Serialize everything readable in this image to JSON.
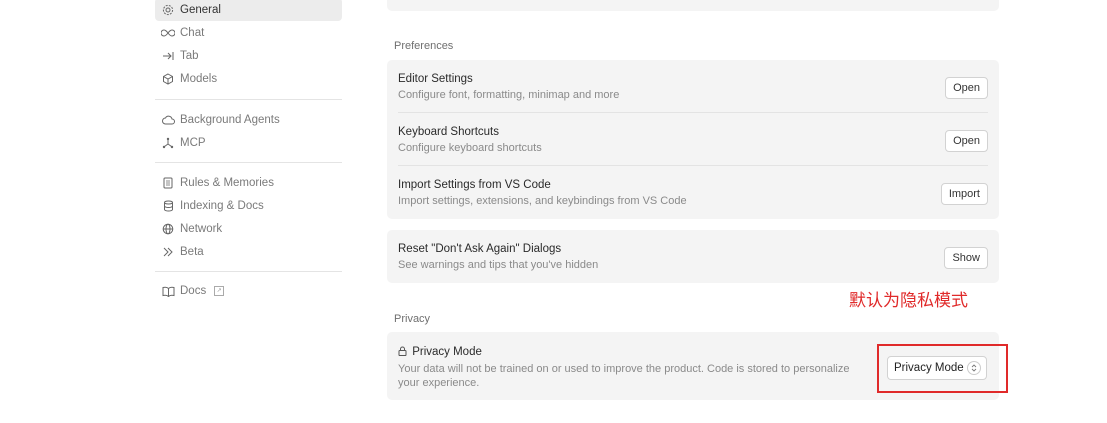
{
  "sidebar": {
    "items": [
      {
        "label": "General",
        "icon": "gear-icon"
      },
      {
        "label": "Chat",
        "icon": "infinity-icon"
      },
      {
        "label": "Tab",
        "icon": "tab-arrow-icon"
      },
      {
        "label": "Models",
        "icon": "cube-icon"
      },
      {
        "label": "Background Agents",
        "icon": "cloud-icon"
      },
      {
        "label": "MCP",
        "icon": "mcp-nodes-icon"
      },
      {
        "label": "Rules & Memories",
        "icon": "document-icon"
      },
      {
        "label": "Indexing & Docs",
        "icon": "database-icon"
      },
      {
        "label": "Network",
        "icon": "globe-icon"
      },
      {
        "label": "Beta",
        "icon": "chevrons-right-icon"
      },
      {
        "label": "Docs",
        "icon": "book-icon"
      }
    ]
  },
  "preferences": {
    "label": "Preferences",
    "rows": [
      {
        "title": "Editor Settings",
        "desc": "Configure font, formatting, minimap and more",
        "button": "Open"
      },
      {
        "title": "Keyboard Shortcuts",
        "desc": "Configure keyboard shortcuts",
        "button": "Open"
      },
      {
        "title": "Import Settings from VS Code",
        "desc": "Import settings, extensions, and keybindings from VS Code",
        "button": "Import"
      }
    ]
  },
  "reset": {
    "title": "Reset \"Don't Ask Again\" Dialogs",
    "desc": "See warnings and tips that you've hidden",
    "button": "Show"
  },
  "privacy": {
    "label": "Privacy",
    "title": "Privacy Mode",
    "desc": "Your data will not be trained on or used to improve the product. Code is stored to personalize your experience.",
    "select_value": "Privacy Mode"
  },
  "annotation": "默认为隐私模式",
  "colors": {
    "annotation": "#e02a2a",
    "card": "#f4f4f4",
    "active_nav": "#ececec"
  }
}
